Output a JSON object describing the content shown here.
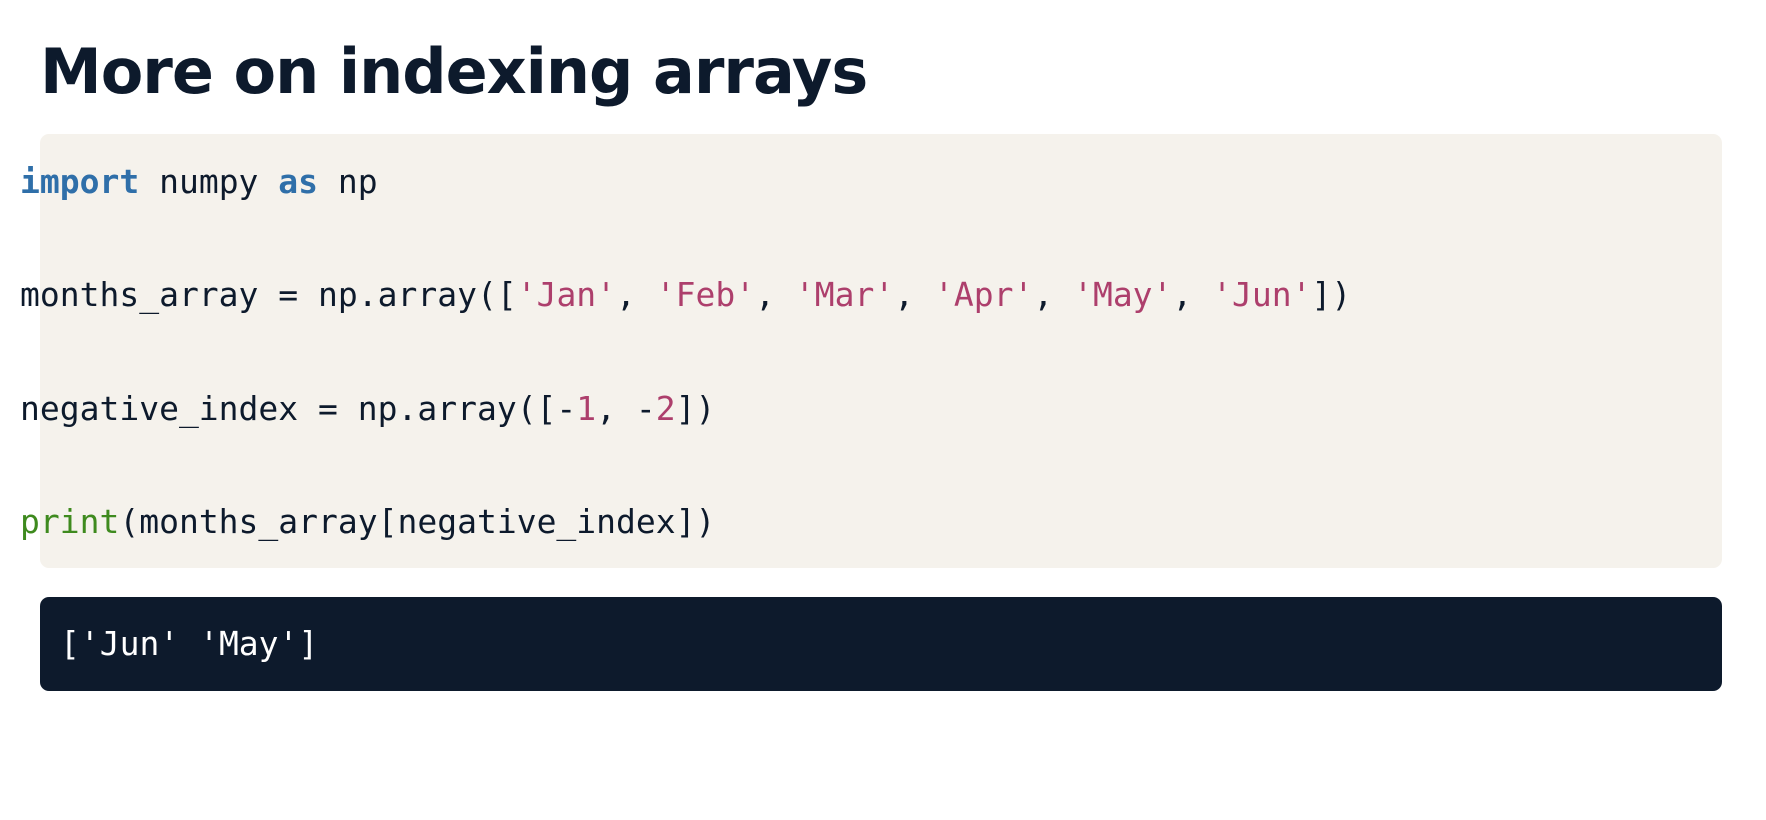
{
  "title": "More on indexing arrays",
  "code": {
    "line1": {
      "kw_import": "import",
      "t1": " numpy ",
      "kw_as": "as",
      "t2": " np"
    },
    "line2": {
      "t1": "months_array = np.array([",
      "s1": "'Jan'",
      "c1": ", ",
      "s2": "'Feb'",
      "c2": ", ",
      "s3": "'Mar'",
      "c3": ", ",
      "s4": "'Apr'",
      "c4": ", ",
      "s5": "'May'",
      "c5": ", ",
      "s6": "'Jun'",
      "t2": "])"
    },
    "line3": {
      "t1": "negative_index = np.array([-",
      "n1": "1",
      "t2": ", -",
      "n2": "2",
      "t3": "])"
    },
    "line4": {
      "fn_print": "print",
      "t1": "(months_array[negative_index])"
    }
  },
  "output": {
    "text": "['Jun' 'May']"
  },
  "colors": {
    "title": "#0d1a2c",
    "code_background": "#f5f2ec",
    "keyword": "#2f6fa9",
    "string": "#ad3f6c",
    "builtin_function": "#3e8a1e",
    "output_background": "#0d1a2c",
    "output_text": "#ffffff"
  }
}
